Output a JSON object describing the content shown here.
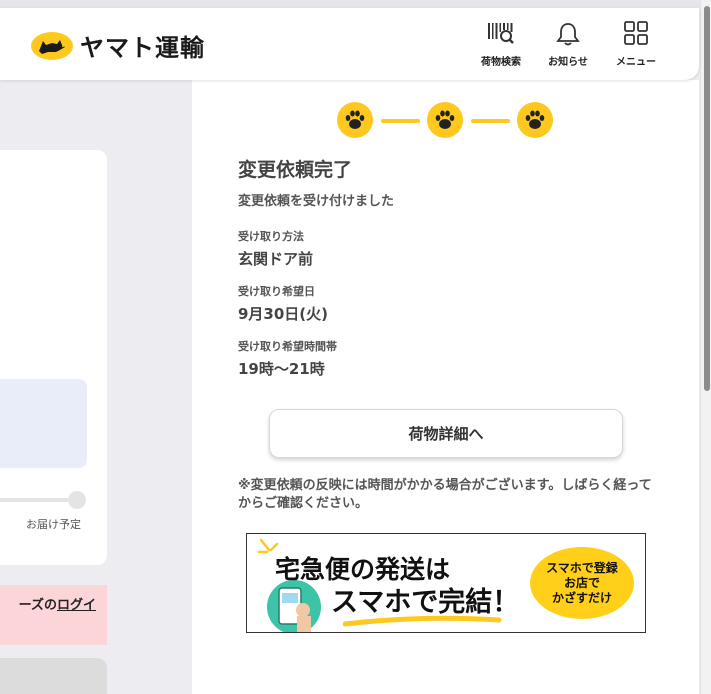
{
  "header": {
    "logo_text": "ヤマト運輸",
    "nav": [
      {
        "label": "荷物検索",
        "icon": "barcode-search-icon"
      },
      {
        "label": "お知らせ",
        "icon": "bell-icon"
      },
      {
        "label": "メニュー",
        "icon": "grid-menu-icon"
      }
    ]
  },
  "left_panel": {
    "delivery_eta_label": "お届け予定",
    "notice_text": "ーズの",
    "notice_link": "ログイ"
  },
  "progress": {
    "total_steps": 3,
    "current_step": 3,
    "icon": "paw-icon"
  },
  "main": {
    "title": "変更依頼完了",
    "subtitle": "変更依頼を受け付けました",
    "fields": [
      {
        "label": "受け取り方法",
        "value": "玄関ドア前"
      },
      {
        "label": "受け取り希望日",
        "value": "9月30日(火)"
      },
      {
        "label": "受け取り希望時間帯",
        "value": "19時〜21時"
      }
    ],
    "detail_button": "荷物詳細へ",
    "note": "※変更依頼の反映には時間がかかる場合がございます。しばらく経ってからご確認ください。"
  },
  "banner": {
    "line1": "宅急便の発送は",
    "line2": "スマホで完結！",
    "badge_line1": "スマホで登録",
    "badge_line2": "お店で",
    "badge_line3": "かざすだけ"
  },
  "colors": {
    "brand_yellow": "#ffc81e",
    "text": "#444444",
    "alert_pink": "#fcd5d8"
  }
}
